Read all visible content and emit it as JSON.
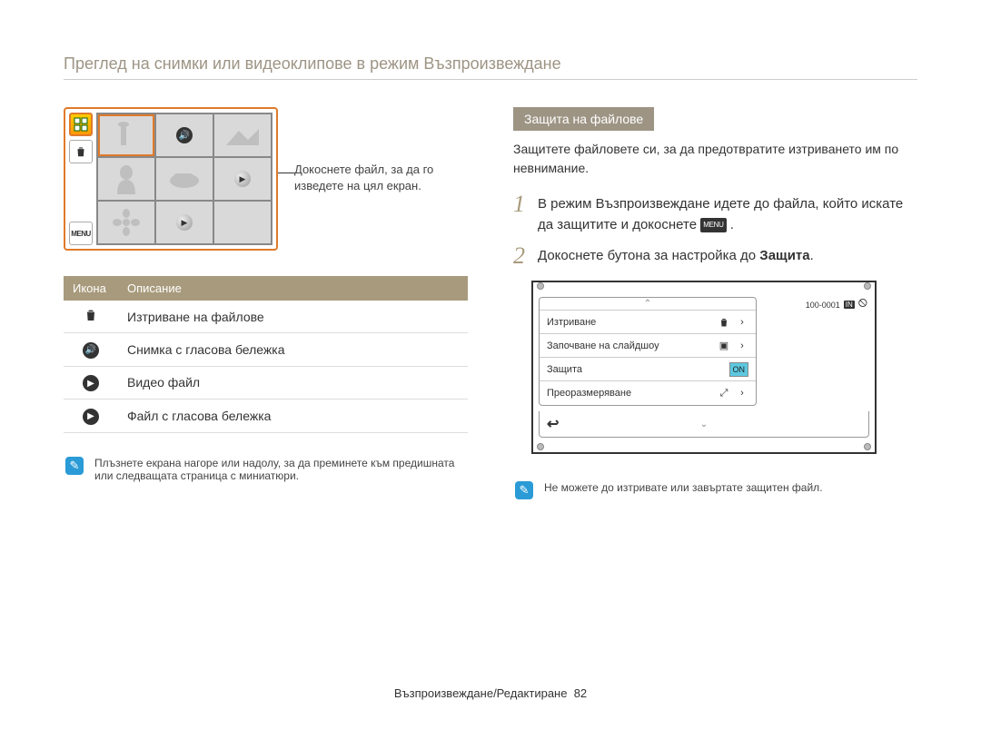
{
  "page_title": "Преглед на снимки или видеоклипове в режим Възпроизвеждане",
  "thumb_callout": "Докоснете файл, за да го изведете на цял екран.",
  "side_menu_label": "MENU",
  "icon_table": {
    "header_icon": "Икона",
    "header_desc": "Описание",
    "rows": [
      {
        "desc": "Изтриване на файлове"
      },
      {
        "desc": "Снимка с гласова бележка"
      },
      {
        "desc": "Видео файл"
      },
      {
        "desc": "Файл с гласова бележка"
      }
    ]
  },
  "left_note": "Плъзнете екрана нагоре или надолу, за да преминете към предишната или следващата страница с миниатюри.",
  "section_heading": "Защита на файлове",
  "section_intro": "Защитете файловете си, за да предотвратите изтриването им по невнимание.",
  "steps": {
    "s1_pre": "В режим Възпроизвеждане идете до файла, който искате да защитите и докоснете ",
    "s1_post": ".",
    "s2_pre": "Докоснете бутона за настройка до ",
    "s2_bold": "Защита",
    "s2_post": "."
  },
  "camera_menu": {
    "items": [
      {
        "label": "Изтриване"
      },
      {
        "label": "Започване на слайдшоу"
      },
      {
        "label": "Защита"
      },
      {
        "label": "Преоразмеряване"
      }
    ],
    "on_label": "ON",
    "file_counter": "100-0001",
    "in_label": "IN"
  },
  "right_note": "Не можете до изтривате или завъртате защитен файл.",
  "footer": {
    "section": "Възпроизвеждане/Редактиране",
    "page_num": "82"
  },
  "menu_badge": "MENU"
}
